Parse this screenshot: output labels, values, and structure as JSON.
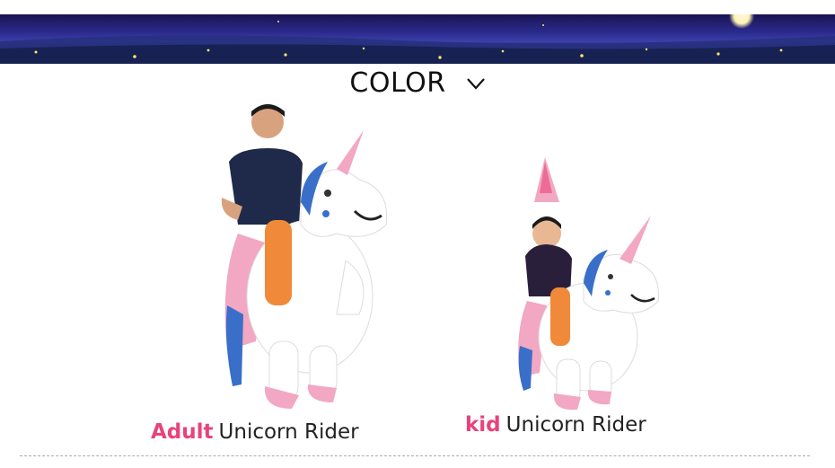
{
  "heading": {
    "title": "COLOR"
  },
  "products": [
    {
      "accent": "Adult",
      "name": "Unicorn Rider"
    },
    {
      "accent": "kid",
      "name": "Unicorn Rider"
    }
  ],
  "colors": {
    "accent": "#e8437a",
    "banner_dark": "#1a1450",
    "banner_mid": "#3b3fa8",
    "unicorn_pink": "#f2a7c3",
    "unicorn_white": "#ffffff",
    "mane_blue": "#3a6fc9"
  },
  "icons": {
    "heading_chevron": "chevron-down-icon"
  }
}
